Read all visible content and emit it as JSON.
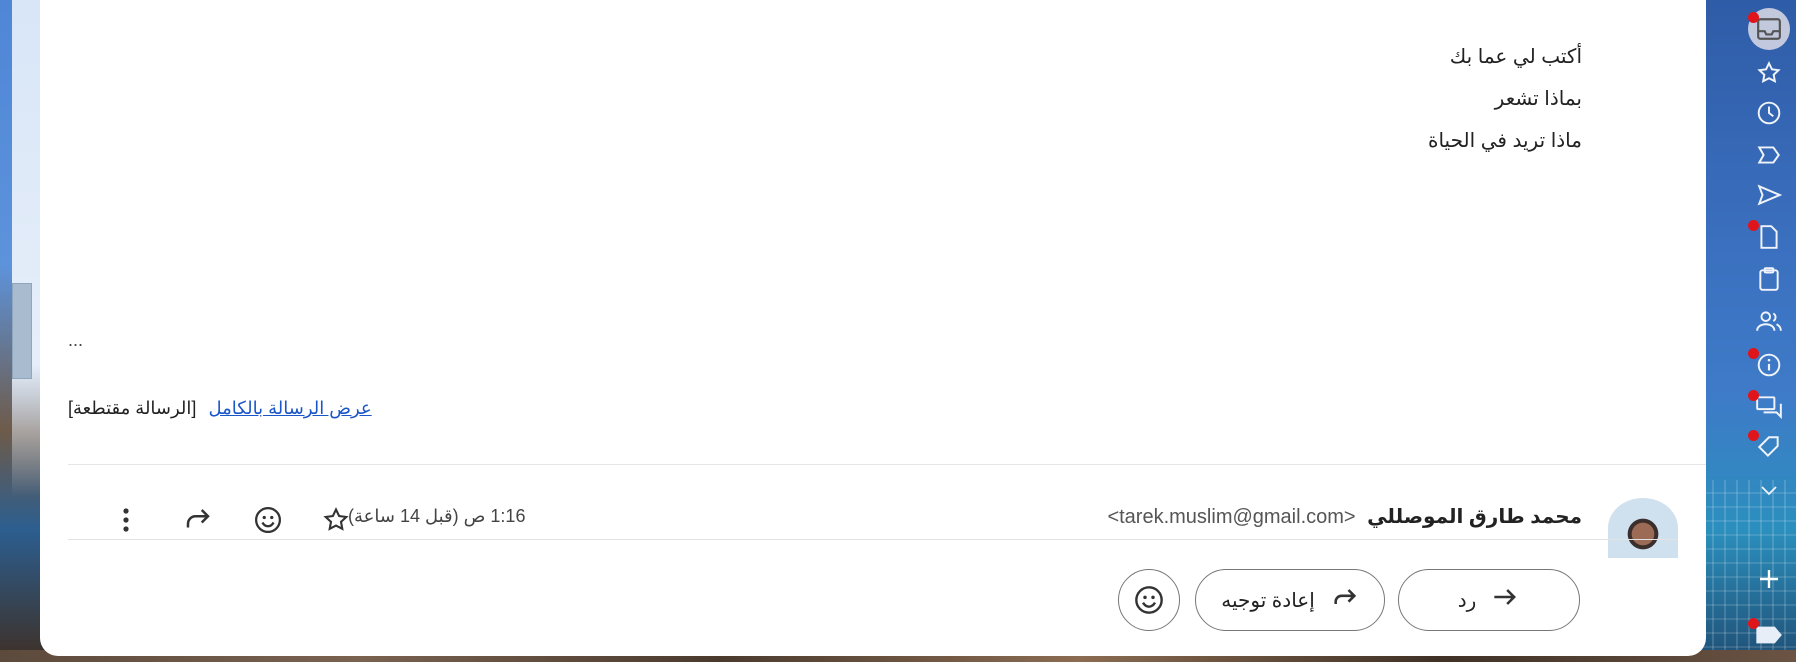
{
  "message": {
    "body_lines": [
      "أكتب لي عما بك",
      "بماذا تشعر",
      "ماذا تريد في الحياة"
    ],
    "ellipsis": "...",
    "clipped_label": "[الرسالة مقتطعة]",
    "view_full_link": "عرض الرسالة بالكامل"
  },
  "header": {
    "sender_name": "محمد طارق الموصللي",
    "sender_email": "<tarek.muslim@gmail.com>",
    "time": "1:16 ص (قبل 14 ساعة)"
  },
  "actions": {
    "reply_label": "رد",
    "forward_label": "إعادة توجيه"
  },
  "rail_icons": [
    "inbox-icon",
    "star-icon",
    "clock-icon",
    "label-icon",
    "send-icon",
    "draft-icon",
    "clipboard-icon",
    "contacts-icon",
    "info-icon",
    "chat-icon",
    "tag-icon",
    "chevron-down-icon",
    "add-icon",
    "label-tag-icon"
  ],
  "colors": {
    "accent_link": "#1a56c8",
    "notification_dot": "#e0151b"
  }
}
